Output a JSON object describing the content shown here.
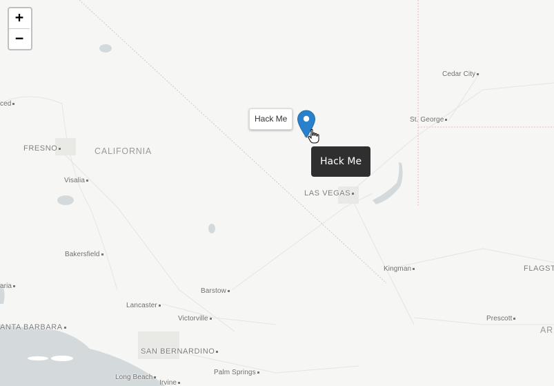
{
  "zoom": {
    "in_label": "+",
    "out_label": "−"
  },
  "states": [
    "CALIFORNIA"
  ],
  "cities": {
    "fresno": "FRESNO",
    "visalia": "Visalia",
    "bakersfield": "Bakersfield",
    "lancaster": "Lancaster",
    "victorville": "Victorville",
    "barstow": "Barstow",
    "san_bernardino": "SAN BERNARDINO",
    "palm_springs": "Palm Springs",
    "long_beach": "Long Beach",
    "irvine": "Irvine",
    "santa_barbara": "ANTA BARBARA",
    "maria": "aria",
    "merced": "ced",
    "las_vegas": "LAS VEGAS",
    "kingman": "Kingman",
    "prescott": "Prescott",
    "flagstaff": "FLAGST",
    "ar": "AR",
    "cedar_city": "Cedar City",
    "st_george": "St. George"
  },
  "marker": {
    "popup_label": "Hack Me",
    "tooltip": "Hack Me",
    "color": "#2a81cb"
  },
  "colors": {
    "land": "#f6f6f4",
    "water": "#d4dadc",
    "roads": "#e2e2df"
  }
}
